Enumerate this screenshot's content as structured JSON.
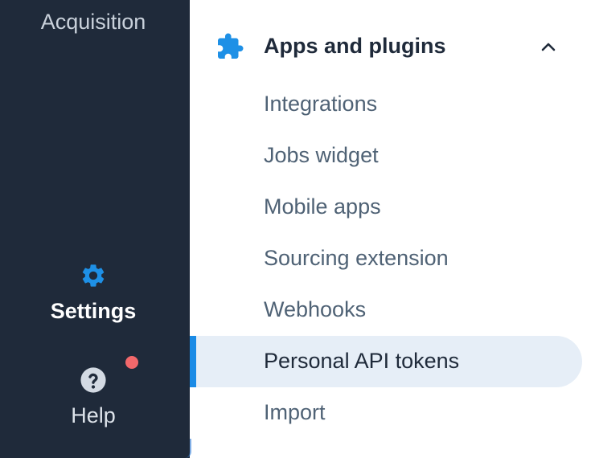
{
  "left_rail": {
    "acquisition_label": "Acquisition",
    "settings_label": "Settings",
    "help_label": "Help"
  },
  "section": {
    "title": "Apps and plugins",
    "expanded": true,
    "items": [
      {
        "label": "Integrations",
        "active": false
      },
      {
        "label": "Jobs widget",
        "active": false
      },
      {
        "label": "Mobile apps",
        "active": false
      },
      {
        "label": "Sourcing extension",
        "active": false
      },
      {
        "label": "Webhooks",
        "active": false
      },
      {
        "label": "Personal API tokens",
        "active": true
      },
      {
        "label": "Import",
        "active": false
      }
    ]
  },
  "colors": {
    "rail_bg": "#1f2a3a",
    "accent": "#1a8be6",
    "active_bg": "#e6eef7",
    "notification": "#f2686b"
  },
  "icons": {
    "section": "puzzle-icon",
    "settings": "gear-icon",
    "help": "question-circle-icon",
    "collapse": "chevron-up-icon"
  }
}
